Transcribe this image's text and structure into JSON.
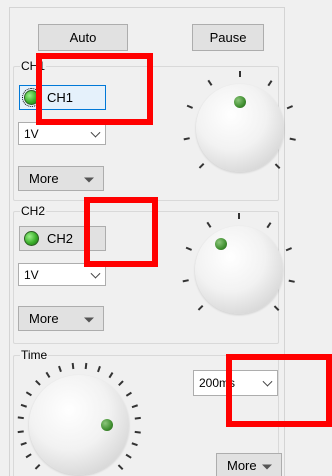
{
  "toolbar": {
    "auto_label": "Auto",
    "pause_label": "Pause"
  },
  "ch1": {
    "group_title": "CH1",
    "toggle_label": "CH1",
    "volts_value": "1V",
    "more_label": "More"
  },
  "ch2": {
    "group_title": "CH2",
    "toggle_label": "CH2",
    "volts_value": "1V",
    "more_label": "More"
  },
  "time": {
    "group_title": "Time",
    "timebase_value": "200ms",
    "more_label": "More"
  },
  "colors": {
    "led_green": "#3bb02b",
    "knob_indicator": "#3f8e2f",
    "highlight_box": "#ff0000",
    "active_border": "#0078d7"
  },
  "icons": {
    "led": "channel-led-icon",
    "dropdown": "chevron-down-icon",
    "more": "triangle-down-icon"
  }
}
